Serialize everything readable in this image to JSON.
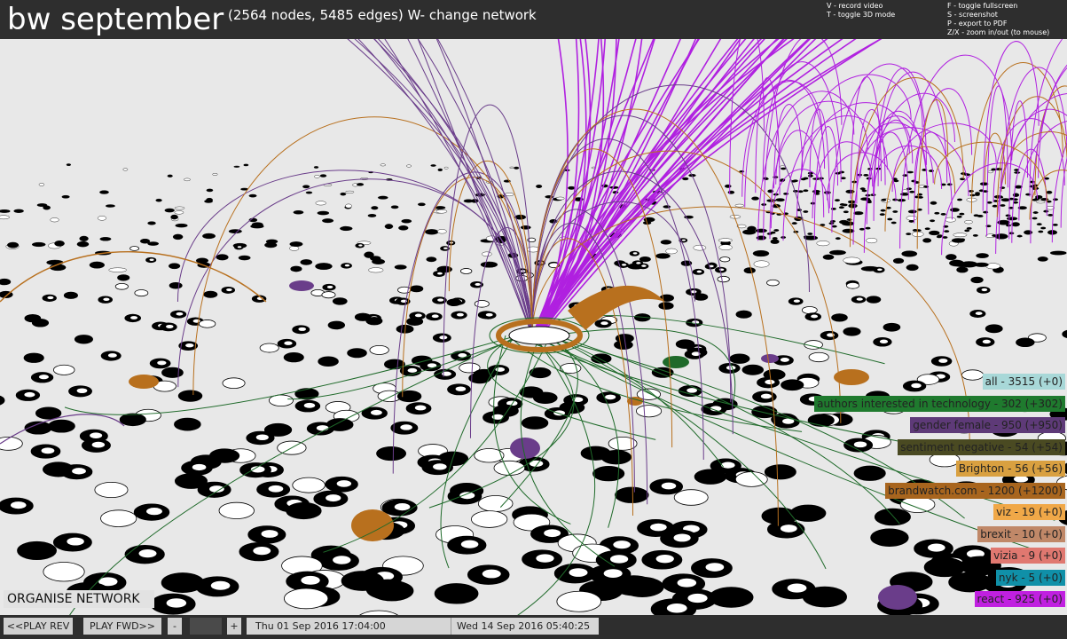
{
  "header": {
    "title": "bw september",
    "subtitle": "(2564 nodes, 5485 edges)  W- change network"
  },
  "shortcuts": {
    "left": [
      "V - record video",
      "T - toggle 3D mode"
    ],
    "right": [
      "F - toggle fullscreen",
      "S - screenshot",
      "P - export to PDF",
      "Z/X - zoom in/out (to mouse)"
    ]
  },
  "legend": [
    {
      "label": "all - 3515 (+0)",
      "color": "#a8d8d8"
    },
    {
      "label": "authors interested in technology - 302 (+302)",
      "color": "#1f7a2e"
    },
    {
      "label": "gender female - 950 (+950)",
      "color": "#5e3a78"
    },
    {
      "label": "sentiment negative - 54 (+54)",
      "color": "#4a4a22"
    },
    {
      "label": "Brighton - 56 (+56)",
      "color": "#d9a040"
    },
    {
      "label": "brandwatch.com - 1200 (+1200)",
      "color": "#a8651e"
    },
    {
      "label": "viz - 19 (+0)",
      "color": "#f0a848"
    },
    {
      "label": "brexit - 10 (+0)",
      "color": "#c08868"
    },
    {
      "label": "vizia - 9 (+0)",
      "color": "#e07870"
    },
    {
      "label": "nyk - 5 (+0)",
      "color": "#1090a8"
    },
    {
      "label": "react - 925 (+0)",
      "color": "#c020e0"
    }
  ],
  "controls": {
    "organise": "ORGANISE NETWORK",
    "play_rev": "<<PLAY REV",
    "play_fwd": "PLAY FWD>>",
    "minus": "-",
    "plus": "+",
    "start_date": "Thu 01 Sep 2016 17:04:00",
    "end_date": "Wed 14 Sep 2016 05:40:25"
  },
  "colors": {
    "background": "#e8e8e8",
    "bar": "#2e2e2e",
    "node_dark": "#000000",
    "edge_purple": "#b020e0",
    "edge_violet": "#6a3d8a",
    "edge_orange": "#b8701e",
    "edge_green": "#1f6a2a"
  }
}
